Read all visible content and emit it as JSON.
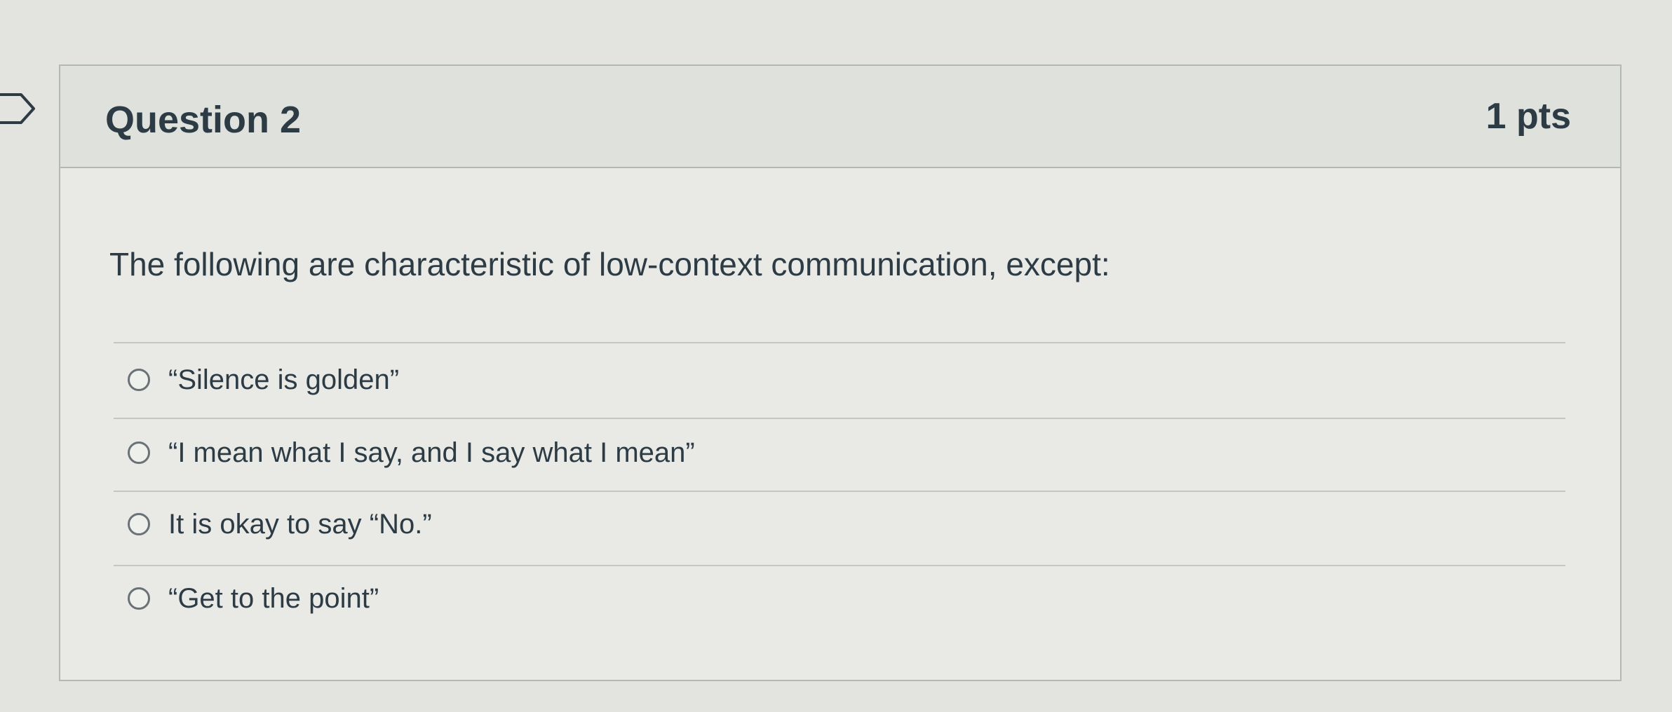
{
  "question": {
    "title": "Question 2",
    "points": "1 pts",
    "text": "The following are characteristic of low-context communication, except:"
  },
  "answers": [
    {
      "label": "“Silence is golden”"
    },
    {
      "label": "“I mean what I say, and I say what I mean”"
    },
    {
      "label": "It is okay to say “No.”"
    },
    {
      "label": "“Get to the point”"
    }
  ],
  "icons": {
    "flag": "flag-question-icon",
    "radio": "radio-unselected-icon"
  },
  "colors": {
    "text": "#2d3b45",
    "border": "#b4b8b3",
    "header_bg": "#dfe1dd",
    "card_bg": "#e9eae6"
  }
}
